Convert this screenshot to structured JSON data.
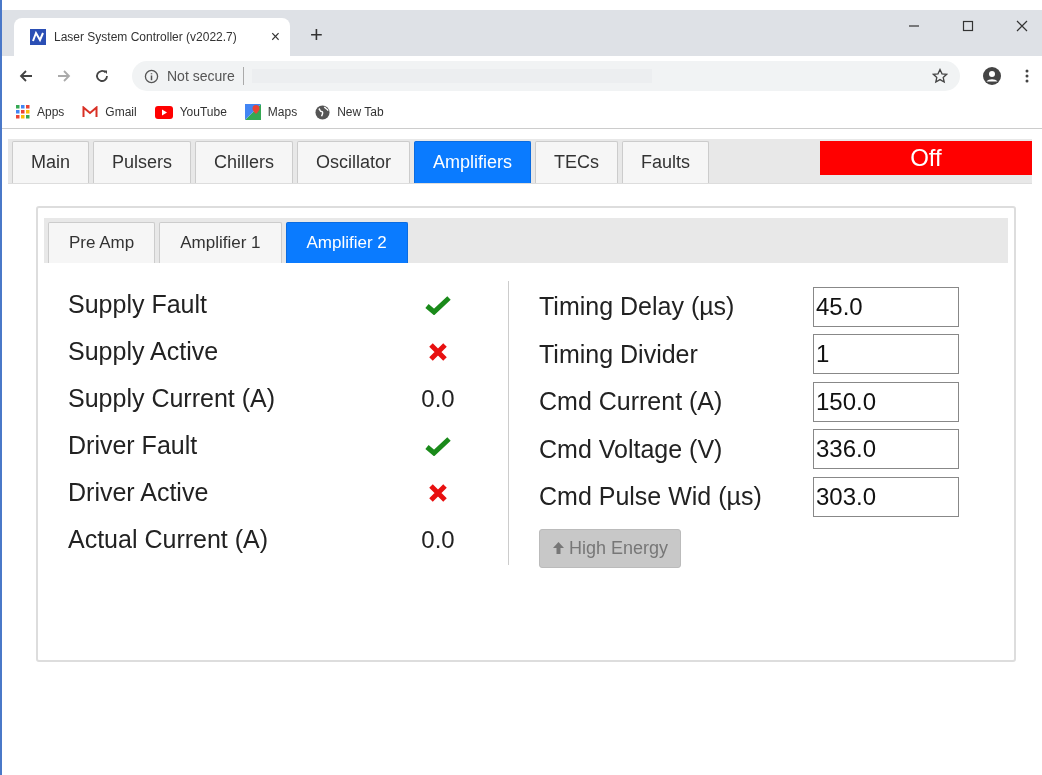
{
  "browser": {
    "tab_title": "Laser System Controller (v2022.7)",
    "tab_close": "×",
    "new_tab": "+",
    "security": "Not secure",
    "bookmarks": [
      {
        "label": "Apps",
        "kind": "apps"
      },
      {
        "label": "Gmail",
        "kind": "mail"
      },
      {
        "label": "YouTube",
        "kind": "video"
      },
      {
        "label": "Maps",
        "kind": "map"
      },
      {
        "label": "New Tab",
        "kind": "web"
      }
    ]
  },
  "main_tabs": [
    {
      "label": "Main",
      "selected": false
    },
    {
      "label": "Pulsers",
      "selected": false
    },
    {
      "label": "Chillers",
      "selected": false
    },
    {
      "label": "Oscillator",
      "selected": false
    },
    {
      "label": "Amplifiers",
      "selected": true
    },
    {
      "label": "TECs",
      "selected": false
    },
    {
      "label": "Faults",
      "selected": false
    }
  ],
  "status": {
    "label": "Off",
    "on": false
  },
  "sub_tabs": [
    {
      "label": "Pre Amp",
      "selected": false
    },
    {
      "label": "Amplifier 1",
      "selected": false
    },
    {
      "label": "Amplifier 2",
      "selected": true
    }
  ],
  "readings": [
    {
      "label": "Supply Fault",
      "kind": "indicator",
      "ok": true
    },
    {
      "label": "Supply Active",
      "kind": "indicator",
      "ok": false
    },
    {
      "label": "Supply Current (A)",
      "kind": "value",
      "value": "0.0"
    },
    {
      "label": "Driver Fault",
      "kind": "indicator",
      "ok": true
    },
    {
      "label": "Driver Active",
      "kind": "indicator",
      "ok": false
    },
    {
      "label": "Actual Current (A)",
      "kind": "value",
      "value": "0.0"
    }
  ],
  "settings": [
    {
      "label": "Timing Delay (µs)",
      "value": "45.0"
    },
    {
      "label": "Timing Divider",
      "value": "1"
    },
    {
      "label": "Cmd Current (A)",
      "value": "150.0"
    },
    {
      "label": "Cmd Voltage (V)",
      "value": "336.0"
    },
    {
      "label": "Cmd Pulse Wid (µs)",
      "value": "303.0"
    }
  ],
  "high_energy_button": {
    "label": "High Energy",
    "disabled": true
  }
}
